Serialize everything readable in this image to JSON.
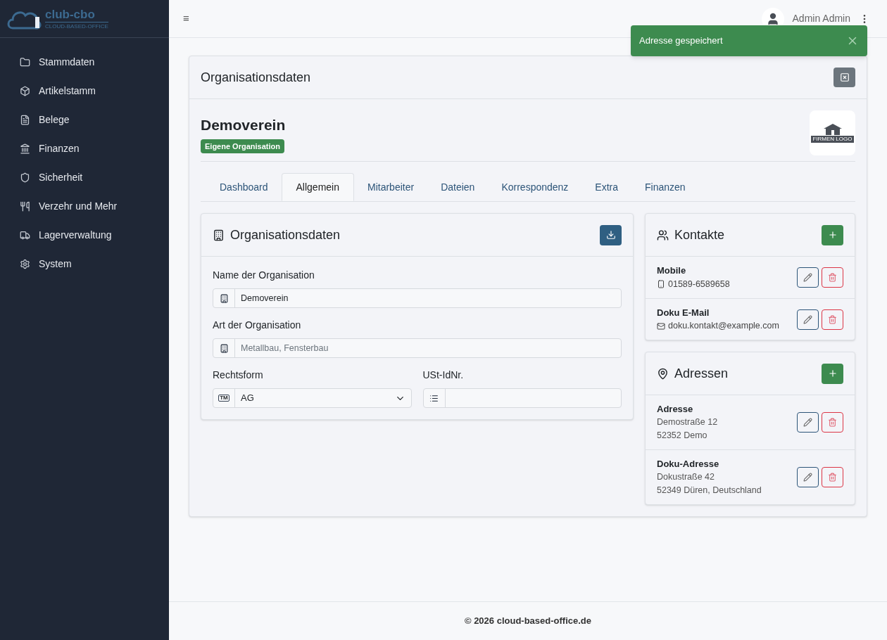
{
  "logo": {
    "name": "club-cbo",
    "tagline": "CLOUD-BASED-OFFICE"
  },
  "sidebar": {
    "items": [
      {
        "label": "Stammdaten",
        "kind": "folder"
      },
      {
        "label": "Artikelstamm",
        "kind": "box"
      },
      {
        "label": "Belege",
        "kind": "file"
      },
      {
        "label": "Finanzen",
        "kind": "finance"
      },
      {
        "label": "Sicherheit",
        "kind": "shield"
      },
      {
        "label": "Verzehr und Mehr",
        "kind": "food"
      },
      {
        "label": "Lagerverwaltung",
        "kind": "truck"
      },
      {
        "label": "System",
        "kind": "gear"
      }
    ]
  },
  "topbar": {
    "menu": "≡",
    "user": "Admin Admin"
  },
  "toast": {
    "message": "Adresse gespeichert"
  },
  "card": {
    "title": "Organisationsdaten",
    "org_name": "Demoverein",
    "badge": "Eigene Organisation",
    "logo_text": "FIRMEN LOGO"
  },
  "tabs": [
    {
      "label": "Dashboard",
      "selected": false
    },
    {
      "label": "Allgemein",
      "selected": true
    },
    {
      "label": "Mitarbeiter",
      "selected": false
    },
    {
      "label": "Dateien",
      "selected": false
    },
    {
      "label": "Korrespondenz",
      "selected": false
    },
    {
      "label": "Extra",
      "selected": false
    },
    {
      "label": "Finanzen",
      "selected": false
    }
  ],
  "form": {
    "title": "Organisationsdaten",
    "fields": [
      {
        "label": "Name der Organisation",
        "value": "Demoverein",
        "kind": "organisation"
      },
      {
        "label": "Art der Organisation",
        "placeholder": "Metallbau, Fensterbau",
        "kind": "organisation"
      },
      {
        "label": "Rechtsform",
        "value": "AG",
        "kind": "legal-form",
        "addon": "TM"
      },
      {
        "label": "USt-IdNr.",
        "kind": "tax-id"
      }
    ]
  },
  "contacts": {
    "title": "Kontakte",
    "items": [
      {
        "name": "Mobile",
        "value": "01589-6589658",
        "kind": "phone"
      },
      {
        "name": "Doku E-Mail",
        "value": "doku.kontakt@example.com",
        "kind": "mail"
      }
    ]
  },
  "addresses": {
    "title": "Adressen",
    "items": [
      {
        "name": "Adresse",
        "lines": [
          "Demostraße 12",
          "52352 Demo"
        ]
      },
      {
        "name": "Doku-Adresse",
        "lines": [
          "Dokustraße 42",
          "52349 Düren, Deutschland"
        ]
      }
    ]
  },
  "footer": "© 2026 cloud-based-office.de"
}
